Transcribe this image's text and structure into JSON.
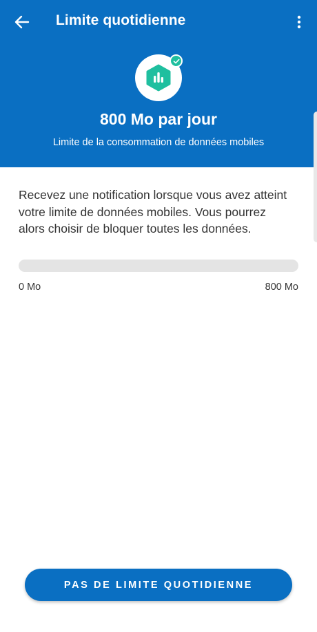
{
  "header": {
    "title": "Limite quotidienne",
    "limit_value": "800 Mo par jour",
    "limit_subtitle": "Limite de la consommation de données mobiles",
    "background_color": "#0a6fc2"
  },
  "icons": {
    "back": "arrow-left-icon",
    "menu": "more-vertical-icon",
    "badge": "bar-chart-icon",
    "badge_check": "check-icon"
  },
  "body": {
    "description": "Recevez une notification lorsque vous avez atteint votre limite de données mobiles. Vous pourrez alors choisir de bloquer toutes les données.",
    "progress_fraction": 0,
    "range_min": "0 Mo",
    "range_max": "800 Mo"
  },
  "footer": {
    "no_limit_button": "PAS DE LIMITE QUOTIDIENNE"
  },
  "colors": {
    "accent": "#0a6fc2",
    "badge_icon": "#1fbf9f",
    "track": "#e4e4e4"
  }
}
